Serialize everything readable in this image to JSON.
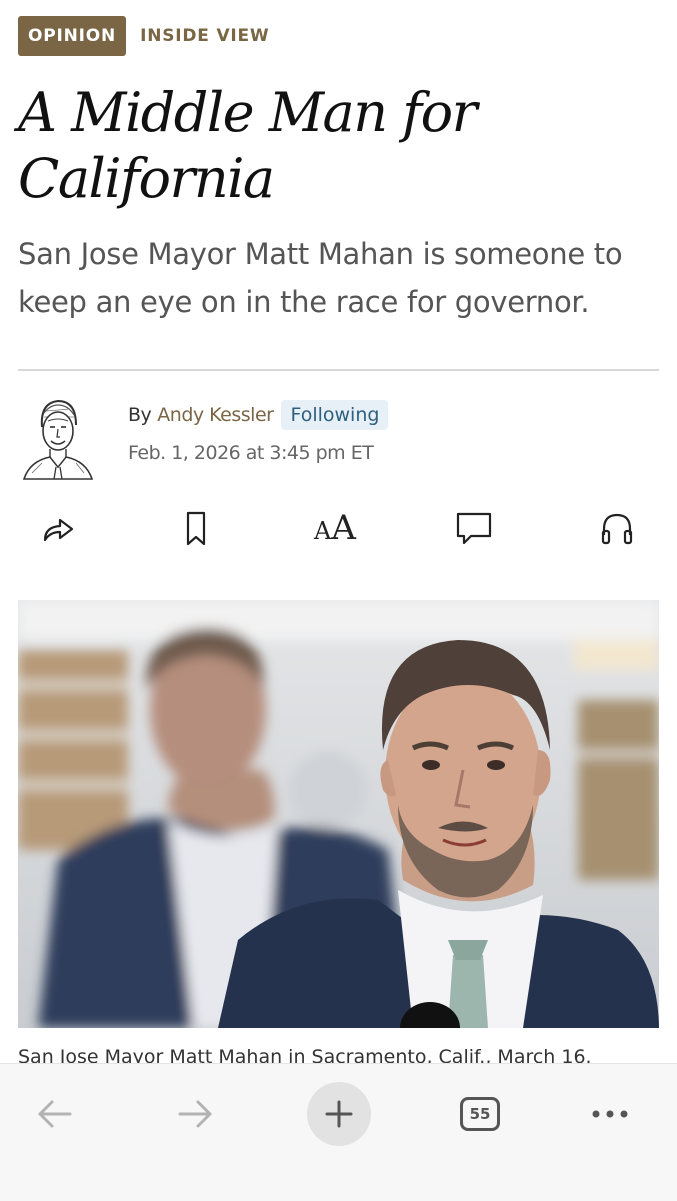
{
  "article": {
    "kicker": "OPINION",
    "section": "INSIDE VIEW",
    "headline": "A Middle Man for California",
    "dek": "San Jose Mayor Matt Mahan is someone to keep an eye on in the race for governor.",
    "byline_prefix": "By",
    "author": "Andy Kessler",
    "follow_status": "Following",
    "dateline": "Feb. 1, 2026 at 3:45 pm ET",
    "caption": "San Jose Mayor Matt Mahan in Sacramento, Calif., March 16."
  },
  "actions": [
    {
      "name": "share",
      "icon": "share-icon"
    },
    {
      "name": "save",
      "icon": "bookmark-icon"
    },
    {
      "name": "text-size",
      "icon": "text-size-icon",
      "label": "AA"
    },
    {
      "name": "comments",
      "icon": "comment-icon"
    },
    {
      "name": "listen",
      "icon": "headphones-icon"
    }
  ],
  "browser": {
    "tab_count": "55",
    "buttons": [
      "back-arrow-icon",
      "forward-arrow-icon",
      "plus-icon",
      "tabs-icon",
      "more-icon"
    ]
  },
  "colors": {
    "accent": "#7a6545",
    "follow_bg": "#e7f0f6",
    "follow_text": "#2f5f80",
    "browser_bar": "#f7f7f7"
  }
}
